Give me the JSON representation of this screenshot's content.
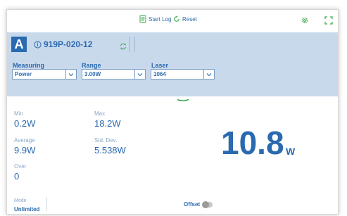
{
  "toolbar": {
    "start_log_label": "Start Log",
    "reset_label": "Reset",
    "icons": [
      "start-log-icon",
      "reset-icon",
      "settings-gear-icon",
      "fullscreen-icon"
    ]
  },
  "channel": {
    "badge": "A",
    "sensor": "919P-020-12"
  },
  "selectors": {
    "measuring": {
      "label": "Measuring",
      "value": "Power"
    },
    "range": {
      "label": "Range",
      "value": "3.00W"
    },
    "laser": {
      "label": "Laser",
      "value": "1064"
    }
  },
  "stats": {
    "min": {
      "label": "Min",
      "value": "0.2W"
    },
    "max": {
      "label": "Max",
      "value": "18.2W"
    },
    "average": {
      "label": "Average",
      "value": "9.9W"
    },
    "stddev": {
      "label": "Std. Dev.",
      "value": "5.538W"
    },
    "over": {
      "label": "Over",
      "value": "0"
    }
  },
  "reading": {
    "value": "10.8",
    "unit": "W"
  },
  "footer": {
    "mode_label": "Mode",
    "mode_value": "Unlimited",
    "offset_label": "Offset",
    "offset_on": false
  },
  "colors": {
    "accent": "#2a6ab0",
    "header_bg": "#c9d9ec",
    "green": "#3aa84a"
  }
}
